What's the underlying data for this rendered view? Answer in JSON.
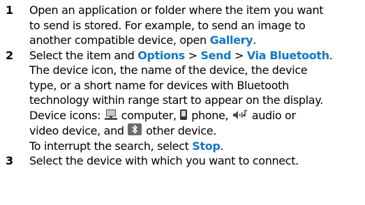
{
  "colors": {
    "keyword": "#1478c8",
    "text": "#000000",
    "bluetooth_tile": "#6b6b6b"
  },
  "steps": [
    {
      "number": "1",
      "text_a": "Open an application or folder where the item you want",
      "text_b": "to send is stored. For example, to send an image to",
      "text_c": "another compatible device, open ",
      "keyword_gallery": "Gallery",
      "text_d": "."
    },
    {
      "number": "2",
      "text_a": "Select the item and ",
      "keyword_options": "Options",
      "separator_1": " > ",
      "keyword_send": "Send",
      "separator_2": " > ",
      "keyword_via_bluetooth": "Via Bluetooth",
      "text_b": ".",
      "text_c": "The device icon, the name of the device, the device",
      "text_d": "type, or a short name for devices with Bluetooth",
      "text_e": "technology within range start to appear on the display.",
      "icons_intro": "Device icons: ",
      "icon_computer": "computer-icon",
      "computer_label": " computer, ",
      "icon_phone": "phone-icon",
      "phone_label": " phone, ",
      "icon_audio": "audio-video-icon",
      "audio_label": " audio or",
      "video_label": "video device, and ",
      "icon_bluetooth": "bluetooth-icon",
      "other_label": " other device.",
      "interrupt_text": "To interrupt the search, select ",
      "keyword_stop": "Stop",
      "interrupt_end": "."
    },
    {
      "number": "3",
      "text_a": "Select the device with which you want to connect."
    }
  ]
}
